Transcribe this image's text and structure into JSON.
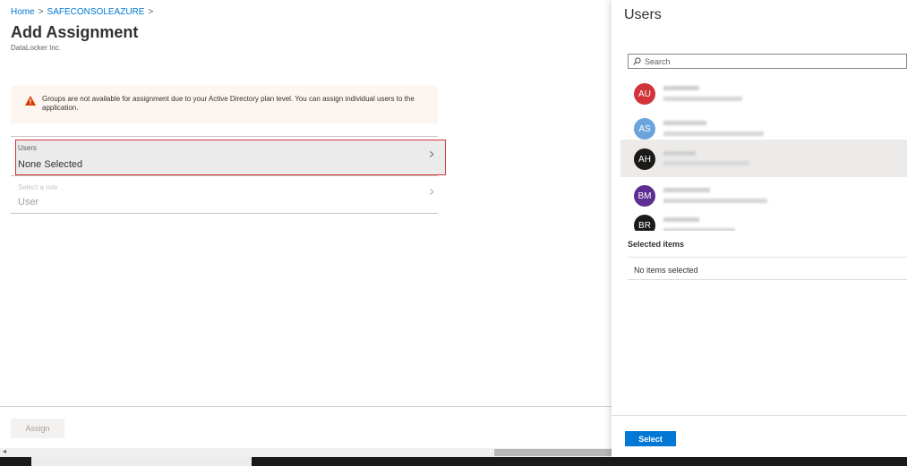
{
  "breadcrumb": {
    "home": "Home",
    "app": "SAFECONSOLEAZURE",
    "separator": ">"
  },
  "page": {
    "title": "Add Assignment",
    "subtitle": "DataLocker Inc."
  },
  "warning": {
    "text": "Groups are not available for assignment due to your Active Directory plan level. You can assign individual users to the application."
  },
  "assignment_rows": {
    "users": {
      "label": "Users",
      "value": "None Selected",
      "chevron": ">"
    },
    "role": {
      "label": "Select a role",
      "value": "User",
      "chevron": ">"
    }
  },
  "footer": {
    "assign_label": "Assign"
  },
  "scrollbar": {
    "left_arrow": "◂"
  },
  "users_panel": {
    "title": "Users",
    "search_placeholder": "Search",
    "users": [
      {
        "initials": "AU",
        "color": "#d13438"
      },
      {
        "initials": "AS",
        "color": "#6ba4dc"
      },
      {
        "initials": "AH",
        "color": "#1b1a19",
        "selected": true
      },
      {
        "initials": "BM",
        "color": "#5c2e91"
      },
      {
        "initials": "BR",
        "color": "#1b1a19"
      }
    ],
    "selected_items_title": "Selected items",
    "no_items_text": "No items selected",
    "select_label": "Select"
  },
  "colors": {
    "accent": "#0078d4",
    "warning": "#d83b01",
    "highlight_border": "#d13438"
  }
}
